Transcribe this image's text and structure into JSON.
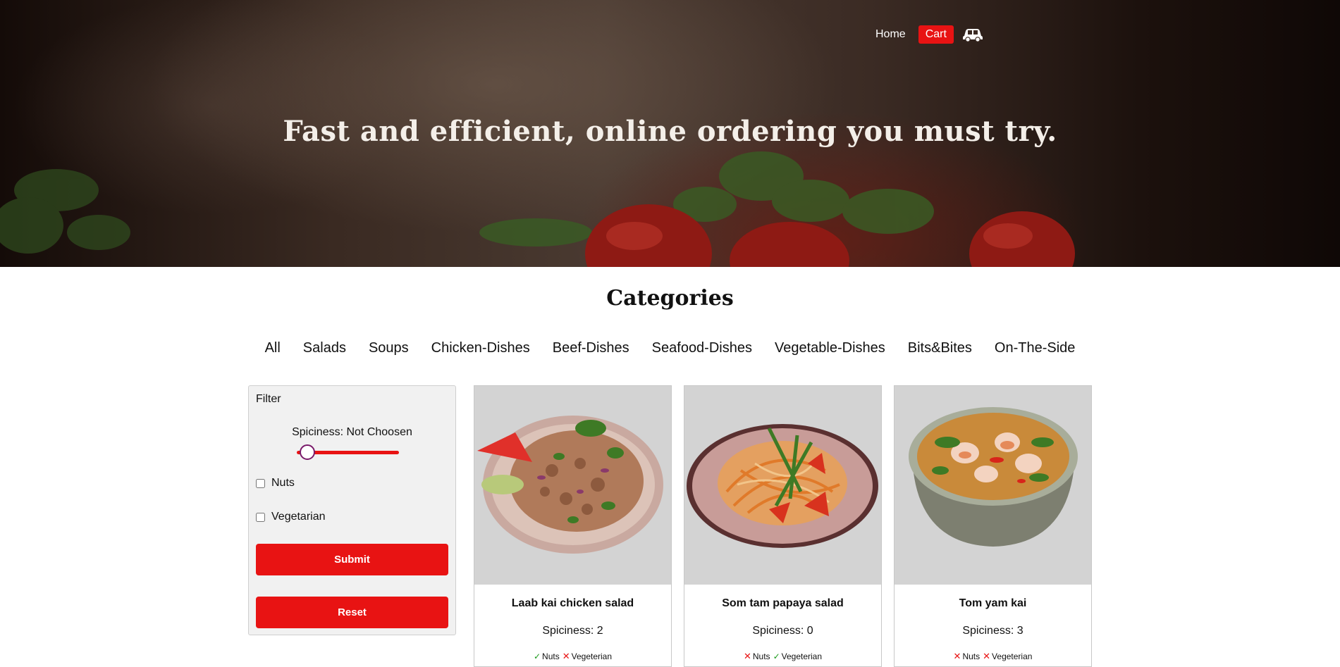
{
  "nav": {
    "home_label": "Home",
    "cart_label": "Cart"
  },
  "hero": {
    "title": "Fast and efficient, online ordering you must try."
  },
  "categories": {
    "title": "Categories",
    "items": [
      "All",
      "Salads",
      "Soups",
      "Chicken-Dishes",
      "Beef-Dishes",
      "Seafood-Dishes",
      "Vegetable-Dishes",
      "Bits&Bites",
      "On-The-Side"
    ]
  },
  "filter": {
    "title": "Filter",
    "spiciness_label": "Spiciness: Not Choosen",
    "spiciness_level": 0,
    "nuts_label": "Nuts",
    "vegetarian_label": "Vegetarian",
    "submit_label": "Submit",
    "reset_label": "Reset"
  },
  "products": [
    {
      "name": "Laab kai chicken salad",
      "spiciness": "Spiciness: 2",
      "nuts_label": "Nuts",
      "nuts": true,
      "veg_label": "Vegeterian",
      "vegetarian": false
    },
    {
      "name": "Som tam papaya salad",
      "spiciness": "Spiciness: 0",
      "nuts_label": "Nuts",
      "nuts": false,
      "veg_label": "Vegeterian",
      "vegetarian": true
    },
    {
      "name": "Tom yam kai",
      "spiciness": "Spiciness: 3",
      "nuts_label": "Nuts",
      "nuts": false,
      "veg_label": "Vegeterian",
      "vegetarian": false
    }
  ],
  "colors": {
    "accent": "#e81313",
    "tick": "#1a9a1a"
  }
}
